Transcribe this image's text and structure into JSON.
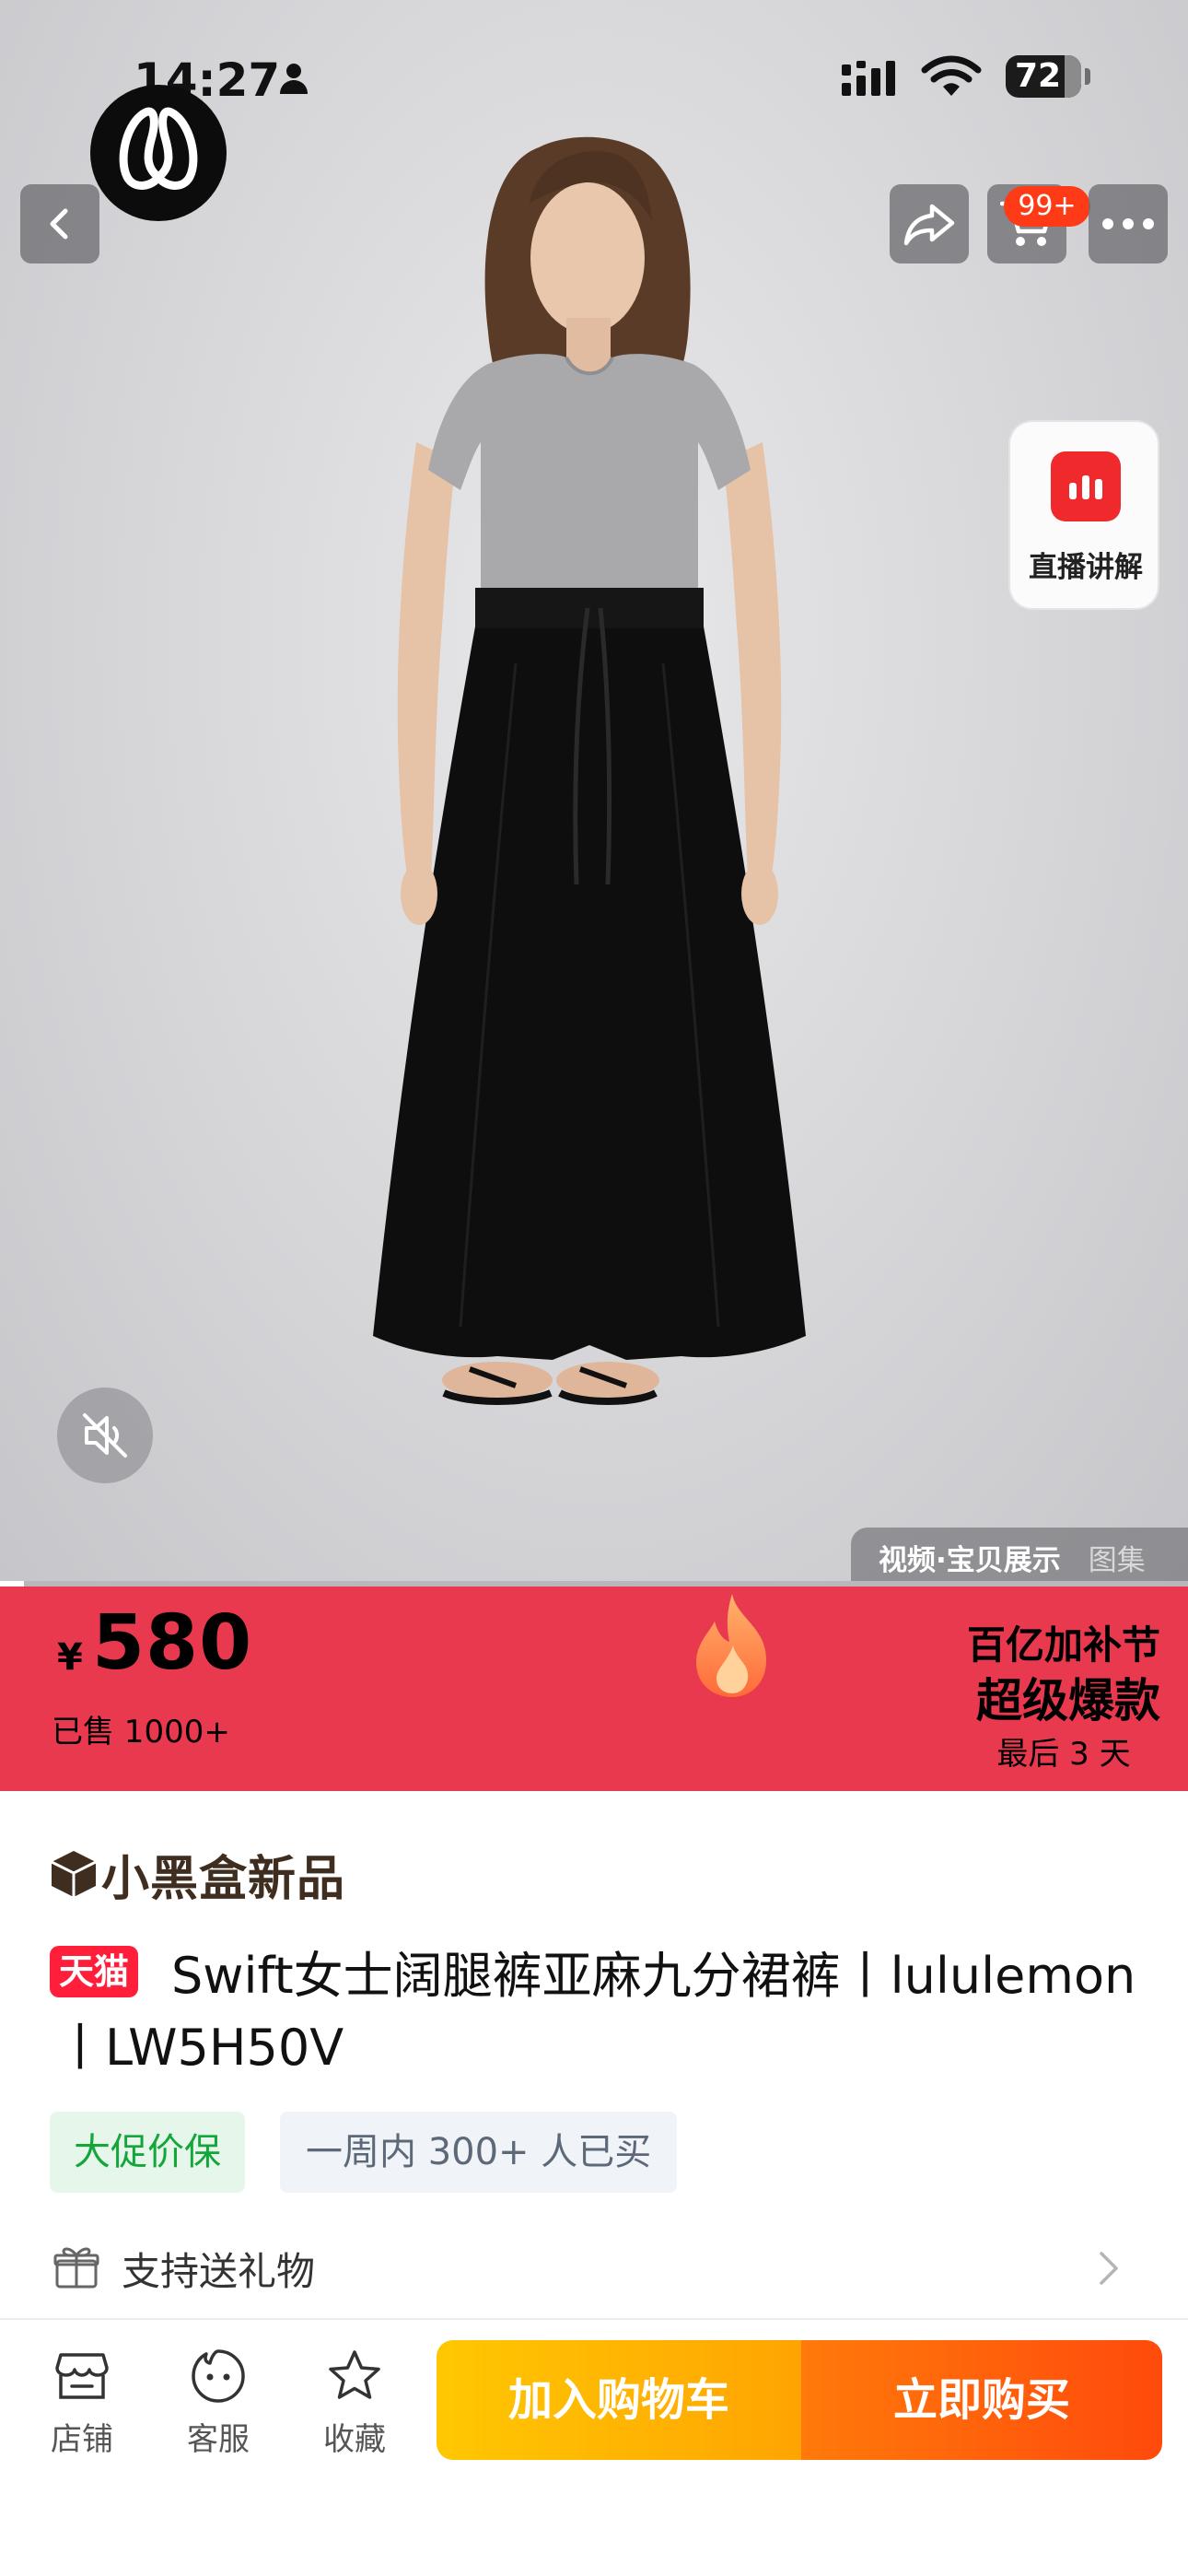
{
  "status_bar": {
    "time": "14:27",
    "battery": "72",
    "icons": [
      "person-icon",
      "signal-icon",
      "wifi-icon",
      "battery-icon"
    ]
  },
  "header": {
    "brand_logo": "lululemon-logo",
    "cart_badge": "99+",
    "icons": [
      "back-icon",
      "share-icon",
      "cart-icon",
      "more-icon"
    ]
  },
  "live": {
    "label": "直播讲解",
    "icon": "live-bars-icon"
  },
  "media": {
    "tab_video": "视频·宝贝展示",
    "tab_gallery": "图集",
    "mute_icon": "speaker-muted-icon",
    "progress": 0.02
  },
  "price_banner": {
    "currency": "¥",
    "price": "580",
    "sold": "已售 1000+",
    "promo_line1": "百亿加补节",
    "promo_line2": "超级爆款",
    "promo_line3": "最后 3 天",
    "flame_icon": "flame-icon",
    "background_color": "#e9394f"
  },
  "product": {
    "brand_label": "小黑盒新品",
    "platform_tag": "天猫",
    "title": "Swift女士阔腿裤亚麻九分裙裤丨lululemon丨LW5H50V",
    "tag_promo": "大促价保",
    "tag_social": "一周内 300+ 人已买",
    "gift_label": "支持送礼物"
  },
  "bottom_bar": {
    "store": "店铺",
    "service": "客服",
    "favorite": "收藏",
    "add_to_cart": "加入购物车",
    "buy_now": "立即购买",
    "cart_button_color": "#ffb302",
    "buy_button_color": "#ff5a0a"
  }
}
